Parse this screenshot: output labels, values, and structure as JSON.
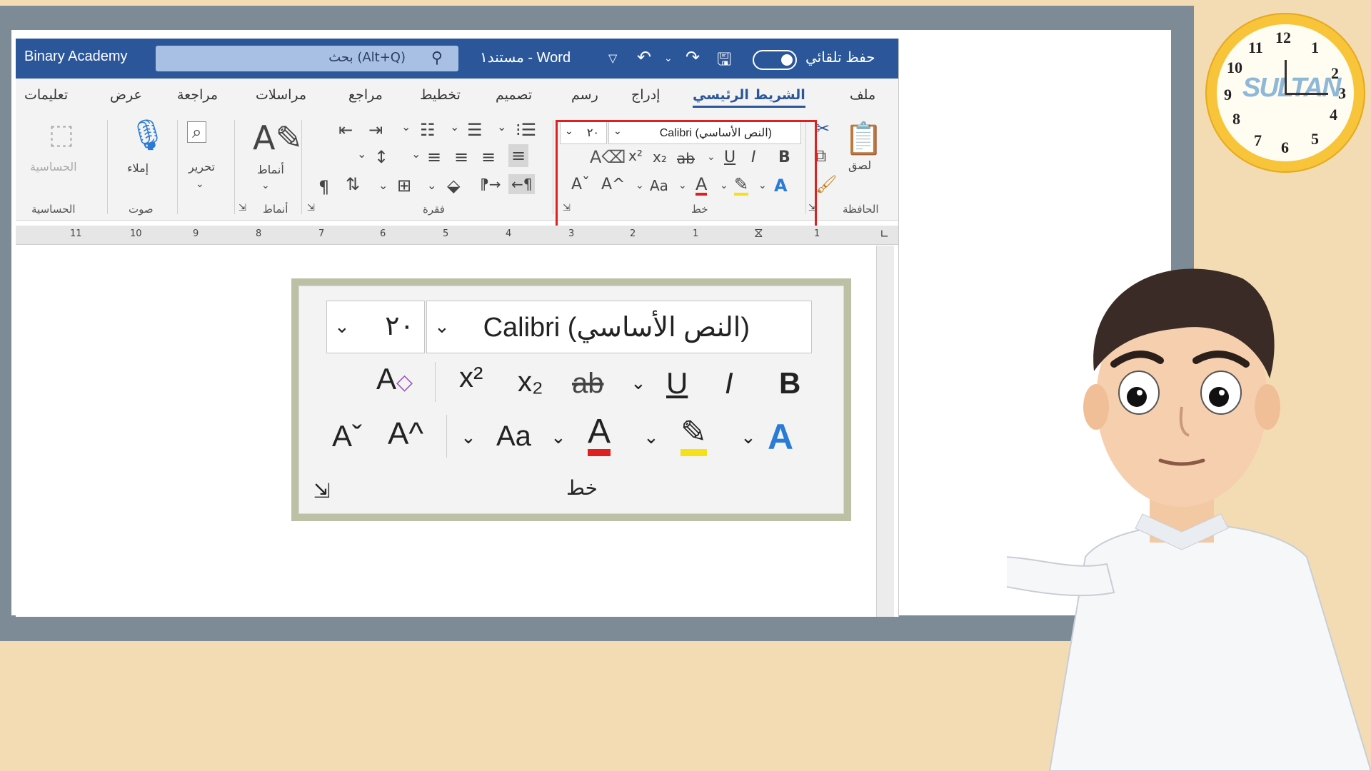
{
  "titlebar": {
    "account": "Binary Academy",
    "search_placeholder": "بحث (Alt+Q)",
    "document_title": "مستند١ - Word",
    "autosave_label": "حفظ تلقائي"
  },
  "tabs": [
    "ملف",
    "الشريط الرئيسي",
    "إدراج",
    "رسم",
    "تصميم",
    "تخطيط",
    "مراجع",
    "مراسلات",
    "مراجعة",
    "عرض",
    "تعليمات"
  ],
  "active_tab": "الشريط الرئيسي",
  "ribbon": {
    "clipboard": {
      "paste_label": "لصق",
      "group_label": "الحافظة"
    },
    "font": {
      "font_name": "Calibri (النص الأساسي)",
      "font_size": "٢٠",
      "group_label": "خط",
      "bold": "B",
      "italic": "I",
      "underline": "U",
      "strike": "ab",
      "subscript": "x₂",
      "superscript": "x²",
      "change_case": "Aa",
      "grow": "A^",
      "shrink": "Aˇ"
    },
    "paragraph": {
      "group_label": "فقرة"
    },
    "styles": {
      "label": "أنماط",
      "group_label": "أنماط"
    },
    "editing": {
      "label": "تحرير"
    },
    "voice": {
      "dictate_label": "إملاء",
      "group_label": "صوت"
    },
    "sensitivity": {
      "label": "الحساسية",
      "group_label": "الحساسية"
    }
  },
  "ruler_numbers": [
    "11",
    "10",
    "9",
    "8",
    "7",
    "6",
    "5",
    "4",
    "3",
    "2",
    "1",
    "1"
  ],
  "zoom_panel": {
    "font_name": "Calibri (النص الأساسي)",
    "font_size": "٢٠",
    "group_label": "خط"
  },
  "clock": {
    "numbers": [
      "12",
      "1",
      "2",
      "3",
      "4",
      "5",
      "6",
      "7",
      "8",
      "9",
      "10",
      "11"
    ],
    "logo": "SULTAN"
  },
  "colors": {
    "word_blue": "#2b579a",
    "highlight_red": "#e02020",
    "font_color_red": "#e02020",
    "highlight_yellow": "#f4e11a",
    "text_effect_blue": "#2a7bd6"
  }
}
